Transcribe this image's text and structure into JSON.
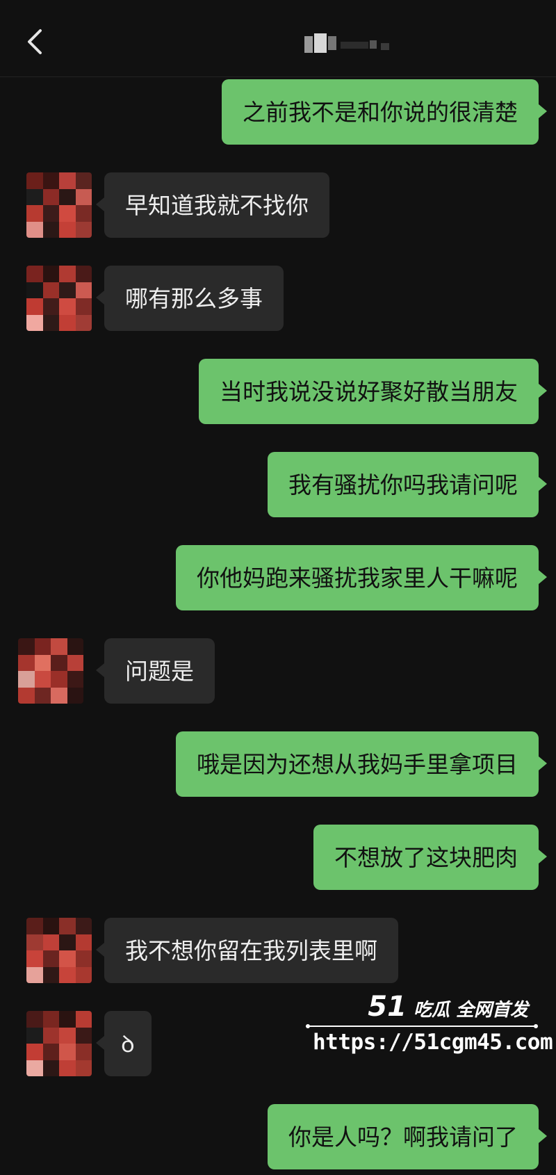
{
  "header": {
    "back_icon": "chevron-left-icon",
    "contact_name_visible": "blurred"
  },
  "messages": [
    {
      "side": "me",
      "text": "之前我不是和你说的很清楚"
    },
    {
      "side": "them",
      "text": "早知道我就不找你"
    },
    {
      "side": "them",
      "text": "哪有那么多事"
    },
    {
      "side": "me",
      "text": "当时我说没说好聚好散当朋友"
    },
    {
      "side": "me",
      "text": "我有骚扰你吗我请问呢"
    },
    {
      "side": "me",
      "text": "你他妈跑来骚扰我家里人干嘛呢"
    },
    {
      "side": "them",
      "text": "问题是"
    },
    {
      "side": "me",
      "text": "哦是因为还想从我妈手里拿项目"
    },
    {
      "side": "me",
      "text": "不想放了这块肥肉"
    },
    {
      "side": "them",
      "text": "我不想你留在我列表里啊"
    },
    {
      "side": "them",
      "text": "ꝺ"
    },
    {
      "side": "me",
      "text": "你是人吗？啊我请问了"
    }
  ],
  "watermark": {
    "number": "51",
    "tagline": "吃瓜 全网首发",
    "url": "https://51cgm45.com"
  },
  "colors": {
    "background": "#111111",
    "my_bubble": "#6cc36c",
    "their_bubble": "#2a2a2a"
  }
}
